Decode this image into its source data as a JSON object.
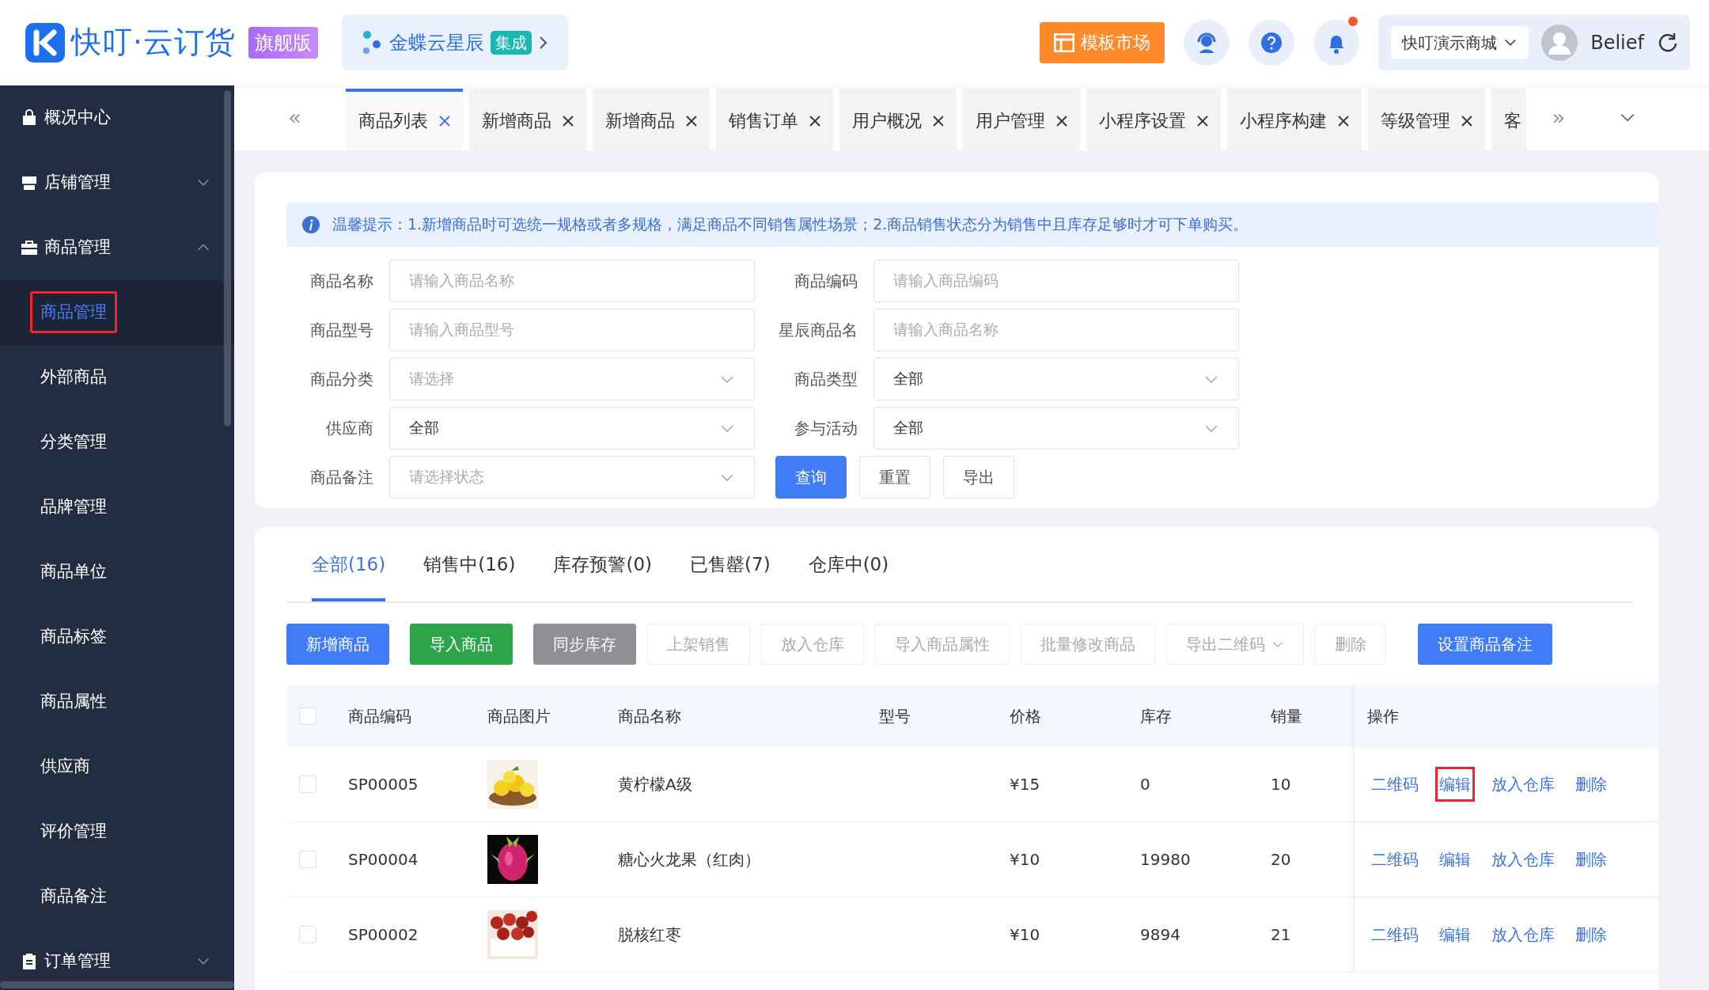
{
  "header": {
    "logo_text": "快叮·云订货",
    "edition": "旗舰版",
    "integration": {
      "name": "金蝶云星辰",
      "badge": "集成"
    },
    "market_button": "模板市场",
    "notifications_unread": true,
    "shop_select": "快叮演示商城",
    "user": "Belief"
  },
  "sidebar": {
    "items": [
      {
        "label": "概况中心"
      },
      {
        "label": "店铺管理",
        "expanded": false
      },
      {
        "label": "商品管理",
        "expanded": true,
        "children": [
          {
            "label": "商品管理",
            "selected": true,
            "annotated": true
          },
          {
            "label": "外部商品",
            "selected": false,
            "annotated": false
          },
          {
            "label": "分类管理",
            "selected": false,
            "annotated": false
          },
          {
            "label": "品牌管理",
            "selected": false,
            "annotated": false
          },
          {
            "label": "商品单位",
            "selected": false,
            "annotated": false
          },
          {
            "label": "商品标签",
            "selected": false,
            "annotated": false
          },
          {
            "label": "商品属性",
            "selected": false,
            "annotated": false
          },
          {
            "label": "供应商",
            "selected": false,
            "annotated": false
          },
          {
            "label": "评价管理",
            "selected": false,
            "annotated": false
          },
          {
            "label": "商品备注",
            "selected": false,
            "annotated": false
          }
        ]
      },
      {
        "label": "订单管理",
        "expanded": false
      }
    ]
  },
  "tab_scroll": {
    "left": "«",
    "right": "»"
  },
  "page_tabs": [
    {
      "label": "商品列表",
      "selected": true
    },
    {
      "label": "新增商品",
      "selected": false
    },
    {
      "label": "新增商品",
      "selected": false
    },
    {
      "label": "销售订单",
      "selected": false
    },
    {
      "label": "用户概况",
      "selected": false
    },
    {
      "label": "用户管理",
      "selected": false
    },
    {
      "label": "小程序设置",
      "selected": false
    },
    {
      "label": "小程序构建",
      "selected": false
    },
    {
      "label": "等级管理",
      "selected": false
    },
    {
      "label": "客",
      "selected": false
    }
  ],
  "notice": "温馨提示：1.新增商品时可选统一规格或者多规格，满足商品不同销售属性场景；2.商品销售状态分为销售中且库存足够时才可下单购买。",
  "filters": [
    {
      "label": "商品名称",
      "kind": "input",
      "placeholder": "请输入商品名称"
    },
    {
      "label": "商品编码",
      "kind": "input",
      "placeholder": "请输入商品编码"
    },
    {
      "label": "商品型号",
      "kind": "input",
      "placeholder": "请输入商品型号"
    },
    {
      "label": "星辰商品名",
      "kind": "input",
      "placeholder": "请输入商品名称"
    },
    {
      "label": "商品分类",
      "kind": "select",
      "placeholder": "请选择"
    },
    {
      "label": "商品类型",
      "kind": "select",
      "value": "全部"
    },
    {
      "label": "供应商",
      "kind": "select",
      "value": "全部"
    },
    {
      "label": "参与活动",
      "kind": "select",
      "value": "全部"
    },
    {
      "label": "商品备注",
      "kind": "select",
      "placeholder": "请选择状态"
    }
  ],
  "filter_buttons": [
    {
      "label": "查询",
      "kind": "primary"
    },
    {
      "label": "重置",
      "kind": "plain"
    },
    {
      "label": "导出",
      "kind": "plain"
    }
  ],
  "status_tabs": [
    {
      "label": "全部(16)",
      "selected": true
    },
    {
      "label": "销售中(16)",
      "selected": false
    },
    {
      "label": "库存预警(0)",
      "selected": false
    },
    {
      "label": "已售罄(7)",
      "selected": false
    },
    {
      "label": "仓库中(0)",
      "selected": false
    }
  ],
  "toolbar": [
    {
      "label": "新增商品",
      "kind": "primary"
    },
    {
      "label": "导入商品",
      "kind": "success"
    },
    {
      "label": "同步库存",
      "kind": "gray"
    },
    {
      "label": "上架销售",
      "kind": "disabled"
    },
    {
      "label": "放入仓库",
      "kind": "disabled"
    },
    {
      "label": "导入商品属性",
      "kind": "disabled"
    },
    {
      "label": "批量修改商品",
      "kind": "disabled"
    },
    {
      "label": "导出二维码",
      "kind": "dropdown"
    },
    {
      "label": "删除",
      "kind": "disabled"
    },
    {
      "label": "设置商品备注",
      "kind": "primary"
    }
  ],
  "table": {
    "select_all_checked": false,
    "columns": [
      "商品编码",
      "商品图片",
      "商品名称",
      "型号",
      "价格",
      "库存",
      "销量",
      "操作"
    ],
    "rows": [
      {
        "checked": false,
        "code": "SP00005",
        "image": {
          "kind": "picture"
        },
        "name": "黄柠檬A级",
        "price": "¥15",
        "stock": "0",
        "sales": "10",
        "actions": [
          {
            "label": "二维码",
            "annotated": false
          },
          {
            "label": "编辑",
            "annotated": true
          },
          {
            "label": "放入仓库",
            "annotated": false
          },
          {
            "label": "删除",
            "annotated": false
          }
        ]
      },
      {
        "checked": false,
        "code": "SP00004",
        "image": {
          "kind": "picture"
        },
        "name": "糖心火龙果（红肉）",
        "price": "¥10",
        "stock": "19980",
        "sales": "20",
        "actions": [
          {
            "label": "二维码",
            "annotated": false
          },
          {
            "label": "编辑",
            "annotated": false
          },
          {
            "label": "放入仓库",
            "annotated": false
          },
          {
            "label": "删除",
            "annotated": false
          }
        ]
      },
      {
        "checked": false,
        "code": "SP00002",
        "image": {
          "kind": "picture"
        },
        "name": "脱核红枣",
        "price": "¥10",
        "stock": "9894",
        "sales": "21",
        "actions": [
          {
            "label": "二维码",
            "annotated": false
          },
          {
            "label": "编辑",
            "annotated": false
          },
          {
            "label": "放入仓库",
            "annotated": false
          },
          {
            "label": "删除",
            "annotated": false
          }
        ]
      }
    ]
  }
}
